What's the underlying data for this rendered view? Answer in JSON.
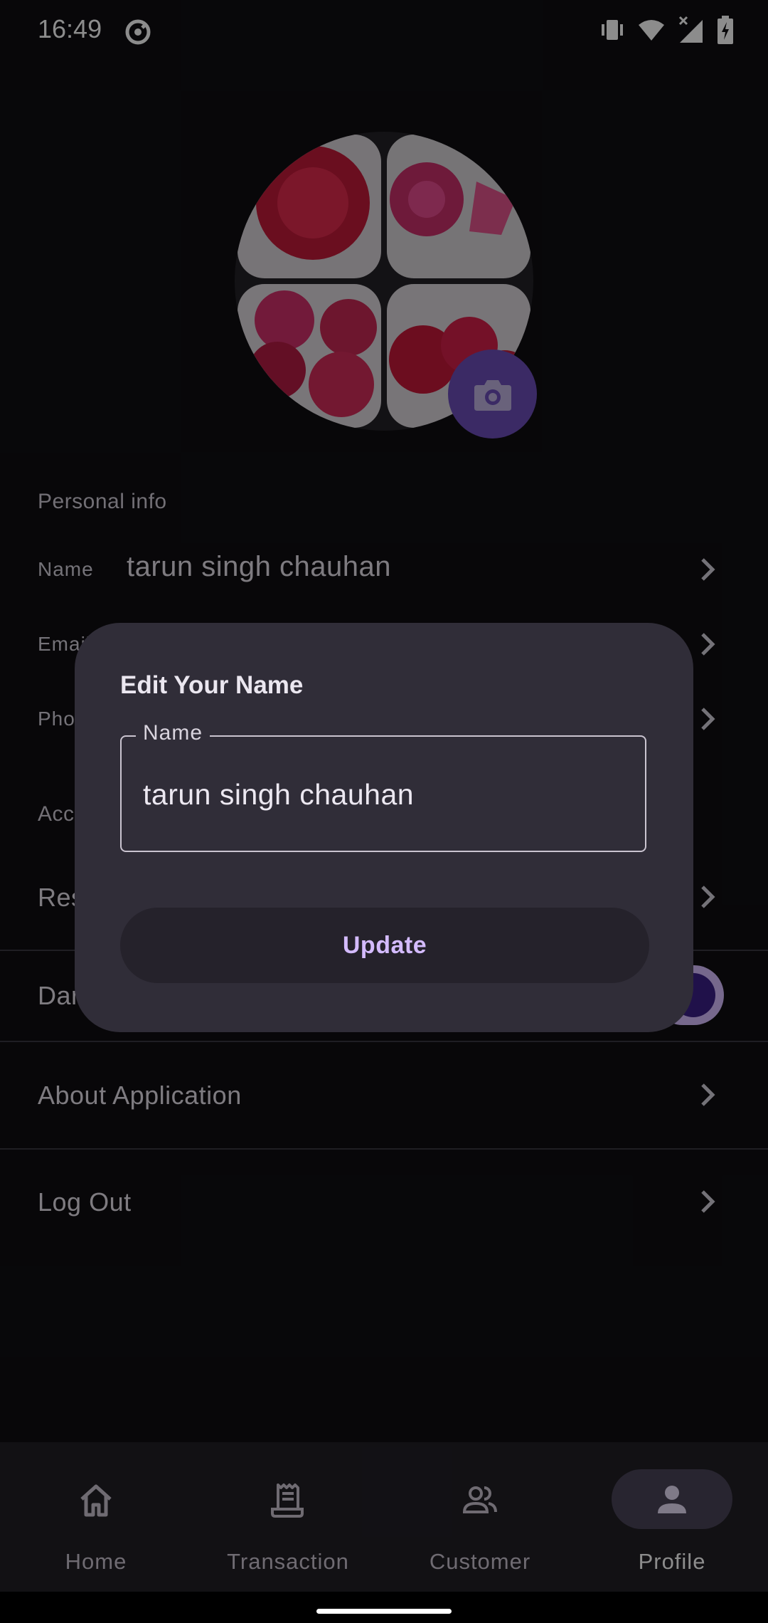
{
  "status_bar": {
    "time": "16:49"
  },
  "profile": {
    "section_personal": "Personal info",
    "name_label": "Name",
    "name_value": "tarun singh chauhan",
    "email_label": "Email",
    "phone_label": "Phone",
    "section_account": "Account",
    "reset_label": "Reset Password",
    "dark_mode_label": "Dark Mode",
    "dark_mode_on": true,
    "about_label": "About Application",
    "logout_label": "Log Out"
  },
  "dialog": {
    "title": "Edit Your Name",
    "field_label": "Name",
    "field_value": "tarun singh chauhan",
    "button_label": "Update"
  },
  "bottom_nav": {
    "items": [
      {
        "label": "Home",
        "icon": "home-icon",
        "active": false
      },
      {
        "label": "Transaction",
        "icon": "receipt-icon",
        "active": false
      },
      {
        "label": "Customer",
        "icon": "people-icon",
        "active": false
      },
      {
        "label": "Profile",
        "icon": "person-icon",
        "active": true
      }
    ]
  },
  "colors": {
    "background": "#0f0e12",
    "accent": "#d4bbff",
    "camera_button": "#6c4db9",
    "dialog_surface": "#302d38"
  }
}
